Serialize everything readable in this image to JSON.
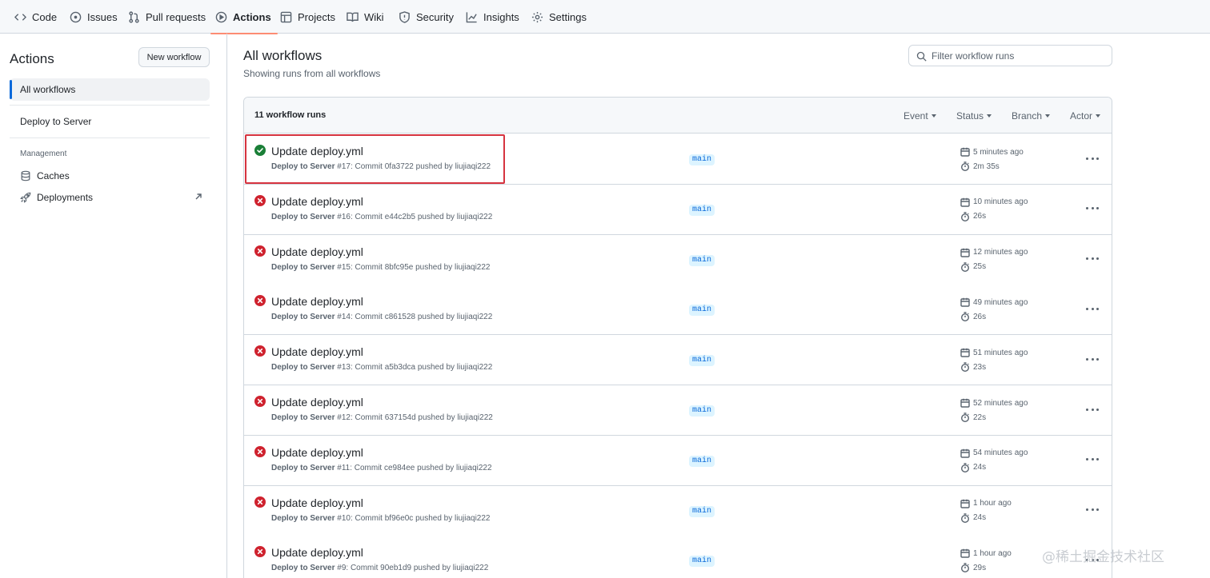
{
  "nav": {
    "tabs": [
      {
        "label": "Code",
        "icon": "code-icon"
      },
      {
        "label": "Issues",
        "icon": "issue-icon"
      },
      {
        "label": "Pull requests",
        "icon": "pull-request-icon"
      },
      {
        "label": "Actions",
        "icon": "play-icon",
        "active": true
      },
      {
        "label": "Projects",
        "icon": "table-icon"
      },
      {
        "label": "Wiki",
        "icon": "book-icon"
      },
      {
        "label": "Security",
        "icon": "shield-icon"
      },
      {
        "label": "Insights",
        "icon": "graph-icon"
      },
      {
        "label": "Settings",
        "icon": "gear-icon"
      }
    ]
  },
  "sidebar": {
    "title": "Actions",
    "new_workflow_label": "New workflow",
    "items": [
      {
        "label": "All workflows",
        "selected": true
      },
      {
        "label": "Deploy to Server"
      }
    ],
    "management_heading": "Management",
    "management_links": [
      {
        "label": "Caches",
        "icon": "database-icon"
      },
      {
        "label": "Deployments",
        "icon": "rocket-icon"
      }
    ]
  },
  "main": {
    "title": "All workflows",
    "subtitle": "Showing runs from all workflows",
    "filter_placeholder": "Filter workflow runs",
    "runs_count": "11 workflow runs",
    "filters": [
      "Event",
      "Status",
      "Branch",
      "Actor"
    ],
    "runs": [
      {
        "status": "success",
        "title": "Update deploy.yml",
        "workflow": "Deploy to Server",
        "detail": " #17: Commit 0fa3722 pushed by liujiaqi222",
        "branch": "main",
        "time": "5 minutes ago",
        "duration": "2m 35s"
      },
      {
        "status": "failure",
        "title": "Update deploy.yml",
        "workflow": "Deploy to Server",
        "detail": " #16: Commit e44c2b5 pushed by liujiaqi222",
        "branch": "main",
        "time": "10 minutes ago",
        "duration": "26s"
      },
      {
        "status": "failure",
        "title": "Update deploy.yml",
        "workflow": "Deploy to Server",
        "detail": " #15: Commit 8bfc95e pushed by liujiaqi222",
        "branch": "main",
        "time": "12 minutes ago",
        "duration": "25s"
      },
      {
        "status": "failure",
        "title": "Update deploy.yml",
        "workflow": "Deploy to Server",
        "detail": " #14: Commit c861528 pushed by liujiaqi222",
        "branch": "main",
        "time": "49 minutes ago",
        "duration": "26s"
      },
      {
        "status": "failure",
        "title": "Update deploy.yml",
        "workflow": "Deploy to Server",
        "detail": " #13: Commit a5b3dca pushed by liujiaqi222",
        "branch": "main",
        "time": "51 minutes ago",
        "duration": "23s"
      },
      {
        "status": "failure",
        "title": "Update deploy.yml",
        "workflow": "Deploy to Server",
        "detail": " #12: Commit 637154d pushed by liujiaqi222",
        "branch": "main",
        "time": "52 minutes ago",
        "duration": "22s"
      },
      {
        "status": "failure",
        "title": "Update deploy.yml",
        "workflow": "Deploy to Server",
        "detail": " #11: Commit ce984ee pushed by liujiaqi222",
        "branch": "main",
        "time": "54 minutes ago",
        "duration": "24s"
      },
      {
        "status": "failure",
        "title": "Update deploy.yml",
        "workflow": "Deploy to Server",
        "detail": " #10: Commit bf96e0c pushed by liujiaqi222",
        "branch": "main",
        "time": "1 hour ago",
        "duration": "24s"
      },
      {
        "status": "failure",
        "title": "Update deploy.yml",
        "workflow": "Deploy to Server",
        "detail": " #9: Commit 90eb1d9 pushed by liujiaqi222",
        "branch": "main",
        "time": "1 hour ago",
        "duration": "29s"
      }
    ]
  },
  "colors": {
    "success": "#1a7f37",
    "failure": "#cf222e",
    "accent": "#0969da",
    "active_tab_underline": "#fd8c73",
    "highlight_box": "#d6333f"
  },
  "watermark": "@稀土掘金技术社区"
}
